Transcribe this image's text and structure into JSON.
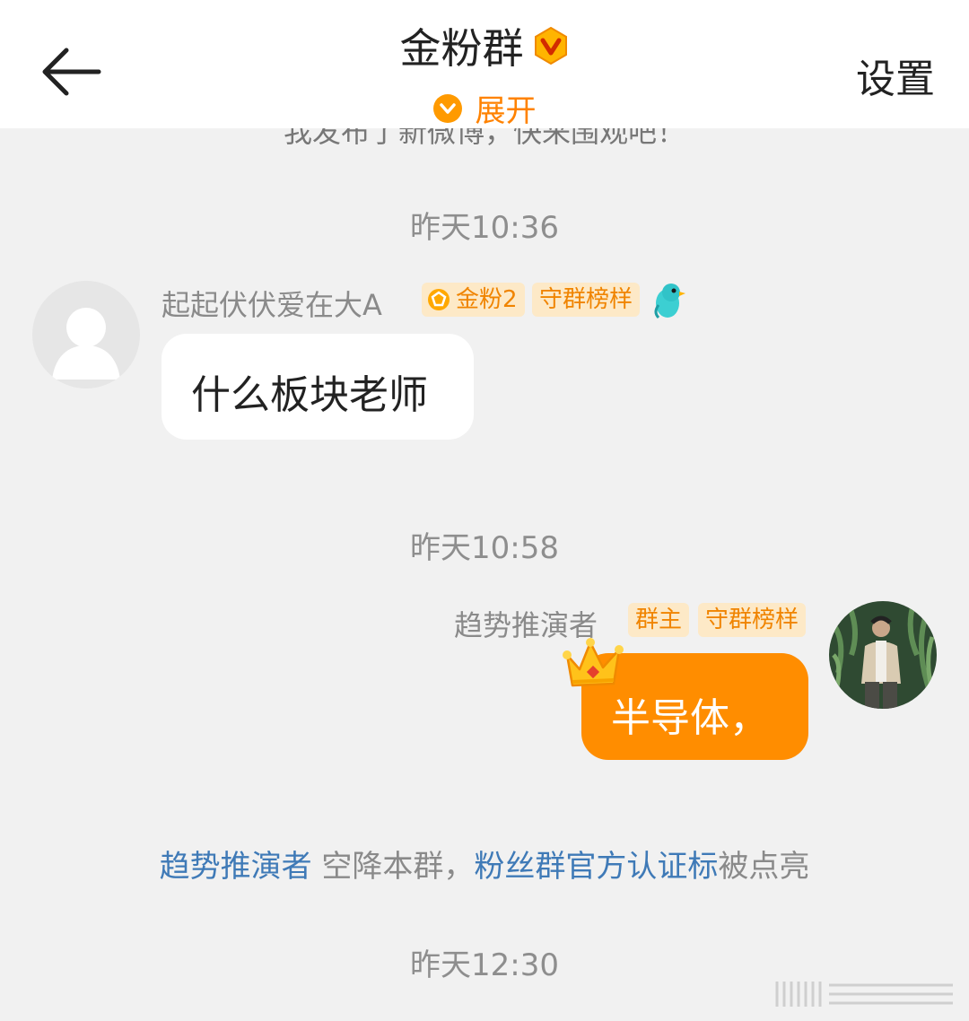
{
  "header": {
    "title": "金粉群",
    "expand_label": "展开",
    "settings_label": "设置",
    "accent": "#ff8200"
  },
  "previous_message_fragment": "我发布了新微博，快来围观吧！",
  "messages": [
    {
      "timestamp": "昨天10:36",
      "sender": "起起伏伏爱在大A",
      "badges": [
        "金粉2",
        "守群榜样"
      ],
      "text": "什么板块老师"
    },
    {
      "timestamp": "昨天10:58",
      "sender": "趋势推演者",
      "badges": [
        "群主",
        "守群榜样"
      ],
      "text": "半导体，"
    }
  ],
  "system_notice": {
    "user": "趋势推演者",
    "middle": " 空降本群，",
    "link": "粉丝群官方认证标",
    "tail": "被点亮"
  },
  "last_timestamp": "昨天12:30",
  "colors": {
    "background": "#f1f1f1",
    "bubble_mine": "#ff8d00",
    "badge_bg": "#fde9c7",
    "badge_text": "#f08400",
    "link": "#3f7ab7"
  }
}
